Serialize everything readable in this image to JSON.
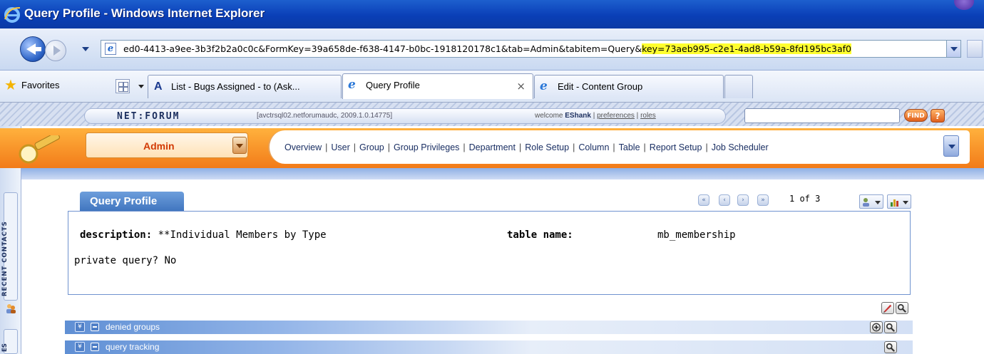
{
  "window": {
    "title": "Query Profile - Windows Internet Explorer"
  },
  "address": {
    "url_prefix": "ed0-4413-a9ee-3b3f2b2a0c0c&FormKey=39a658de-f638-4147-b0bc-1918120178c1&tab=Admin&tabitem=Query&",
    "url_highlight": "key=73aeb995-c2e1-4ad8-b59a-8fd195bc3af0"
  },
  "favorites": {
    "label": "Favorites"
  },
  "tabs": [
    {
      "label": "List - Bugs Assigned - to (Ask..."
    },
    {
      "label": "Query Profile",
      "close": "×"
    },
    {
      "label": "Edit - Content Group"
    }
  ],
  "netforum": {
    "logo": "NET:FORUM",
    "server": "[avctrsql02.netforumaudc, 2009.1.0.14775]",
    "welcome_prefix": "welcome ",
    "user": "EShank",
    "sep": " | ",
    "preferences": "preferences",
    "roles": "roles",
    "search_value": "",
    "find_label": "FIND",
    "help_label": "?",
    "module": "Admin",
    "nav": [
      "Overview",
      "User",
      "Group",
      "Group Privileges",
      "Department",
      "Role Setup",
      "Column",
      "Table",
      "Report Setup",
      "Job Scheduler"
    ]
  },
  "rail": {
    "recent_contacts": "RECENT CONTACTS",
    "es": "ES"
  },
  "profile": {
    "tab_label": "Query Profile",
    "pager": {
      "first": "«",
      "prev": "‹",
      "next": "›",
      "last": "»",
      "text": "1 of 3"
    },
    "description_label": "description:",
    "description_value": "**Individual Members by Type",
    "table_label": "table name:",
    "table_value": "mb_membership",
    "private_label": "private query?",
    "private_value": "No"
  },
  "sections": [
    {
      "label": "denied groups",
      "chevron": "¥"
    },
    {
      "label": "query tracking",
      "chevron": "¥"
    }
  ],
  "colors": {
    "titlebar": "#0a3fb7",
    "accent_orange": "#f27b19",
    "module_text": "#d23a05",
    "profile_blue": "#4176bf",
    "highlight": "#ffff2f"
  }
}
